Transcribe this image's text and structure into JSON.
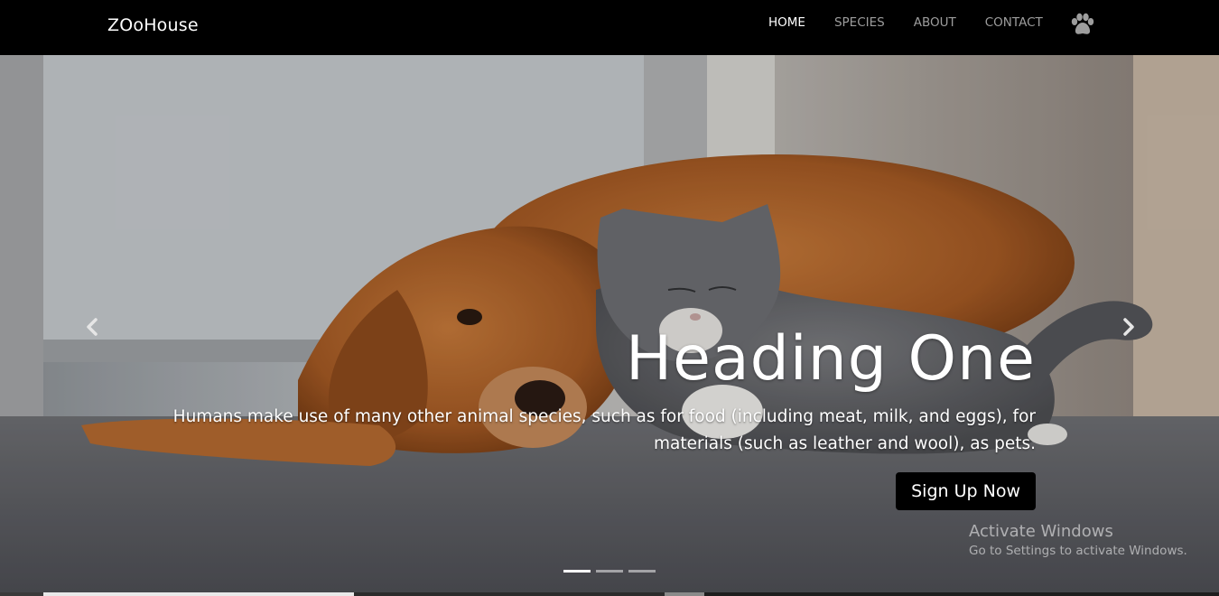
{
  "navbar": {
    "brand": "ZOoHouse",
    "links": [
      {
        "label": "HOME",
        "active": true
      },
      {
        "label": "SPECIES",
        "active": false
      },
      {
        "label": "ABOUT",
        "active": false
      },
      {
        "label": "CONTACT",
        "active": false
      }
    ],
    "icon": "paw-icon"
  },
  "carousel": {
    "heading": "Heading One",
    "text": "Humans make use of many other animal species, such as for food (including meat, milk, and eggs), for materials (such as leather and wool), as pets.",
    "button_label": "Sign Up Now",
    "prev_icon": "chevron-left-icon",
    "next_icon": "chevron-right-icon",
    "slide_count": 3,
    "active_slide": 1
  },
  "watermark": {
    "title": "Activate Windows",
    "subtitle": "Go to Settings to activate Windows."
  },
  "colors": {
    "navbar_bg": "#000000",
    "nav_active": "#ffffff",
    "nav_inactive": "#9d9d9d",
    "button_bg": "#000000"
  }
}
